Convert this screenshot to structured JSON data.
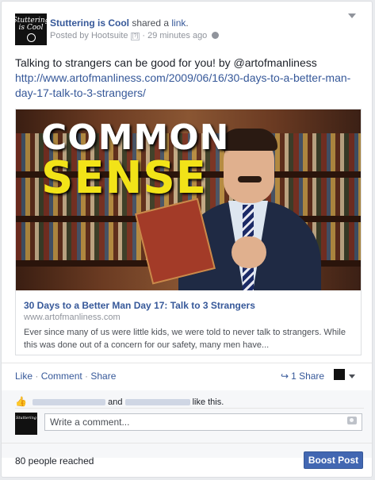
{
  "post": {
    "page_name": "Stuttering is Cool",
    "shared_text": " shared a ",
    "shared_link_word": "link",
    "shared_period": ".",
    "posted_by": "Posted by Hootsuite",
    "help_mark": "[?]",
    "time": " · 29 minutes ago",
    "avatar_text_line1": "Stuttering",
    "avatar_text_line2": "is Cool",
    "message": "Talking to strangers can be good for you! by @artofmanliness",
    "message_link": "http://www.artofmanliness.com/2009/06/16/30-days-to-a-better-man-day-17-talk-to-3-strangers/"
  },
  "link_preview": {
    "image_text_line1": "COMMON",
    "image_text_line2": "SENSE",
    "title": "30 Days to a Better Man Day 17: Talk to 3 Strangers",
    "domain": "www.artofmanliness.com",
    "description": "Ever since many of us were little kids, we were told to never talk to strangers. While this was done out of a concern for our safety, many men have..."
  },
  "actions": {
    "like": "Like",
    "comment": "Comment",
    "share": "Share",
    "separator": " · ",
    "share_count": "1 Share"
  },
  "likes": {
    "and_text": "and",
    "like_this": "like this."
  },
  "comment_box": {
    "placeholder": "Write a comment..."
  },
  "footer": {
    "reached": "80 people reached",
    "boost_button": "Boost Post"
  },
  "colors": {
    "link_blue": "#365899",
    "boost_button": "#4267b2",
    "headline_yellow": "#f2e318"
  },
  "icons": [
    "globe-icon",
    "dropdown-caret-icon",
    "share-arrow-icon",
    "like-thumb-icon",
    "camera-icon"
  ]
}
